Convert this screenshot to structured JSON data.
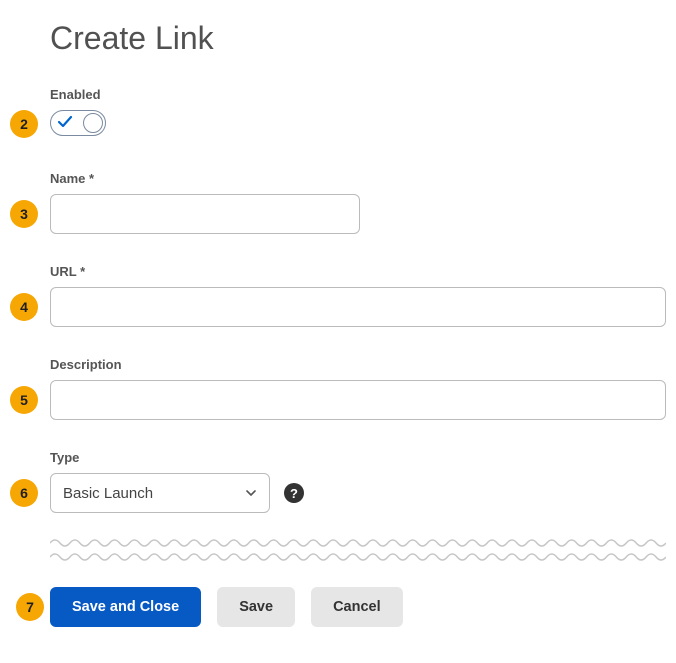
{
  "title": "Create Link",
  "markers": {
    "enabled": "2",
    "name": "3",
    "url": "4",
    "description": "5",
    "type": "6",
    "buttons": "7"
  },
  "fields": {
    "enabled": {
      "label": "Enabled",
      "value": true
    },
    "name": {
      "label": "Name *",
      "value": ""
    },
    "url": {
      "label": "URL *",
      "value": ""
    },
    "description": {
      "label": "Description",
      "value": ""
    },
    "type": {
      "label": "Type",
      "selected": "Basic Launch"
    }
  },
  "buttons": {
    "save_close": "Save and Close",
    "save": "Save",
    "cancel": "Cancel"
  }
}
